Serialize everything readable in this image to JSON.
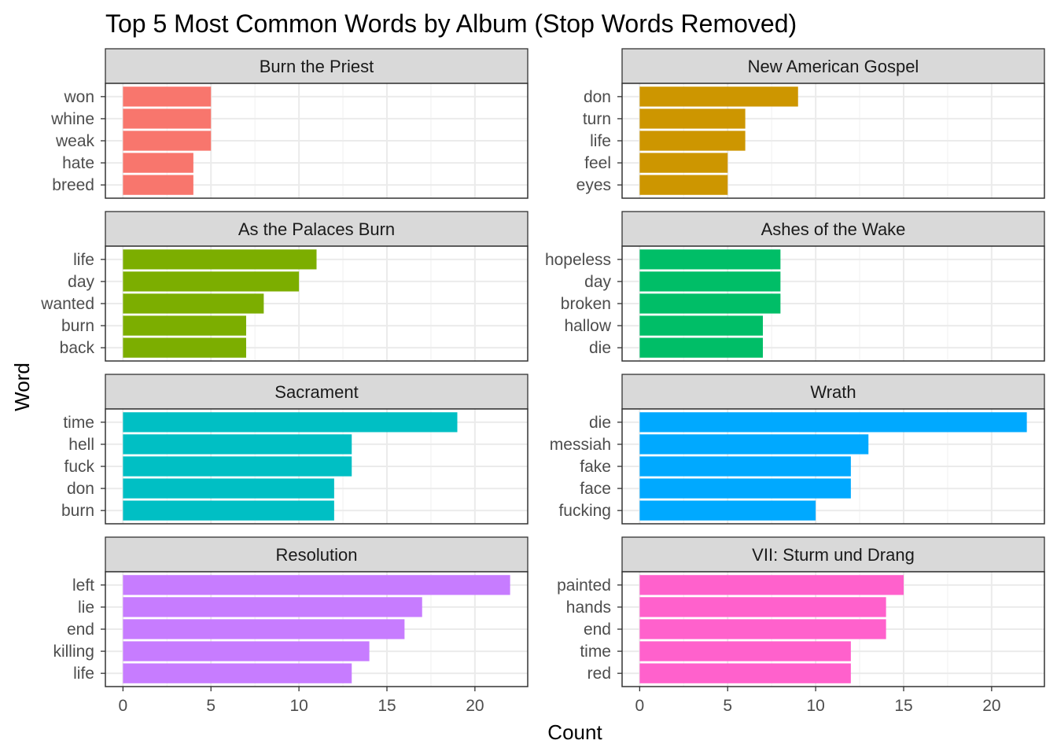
{
  "chart_data": {
    "type": "bar",
    "orientation": "horizontal",
    "title": "Top 5 Most Common Words by Album (Stop Words Removed)",
    "xlabel": "Count",
    "ylabel": "Word",
    "xlim": [
      -1,
      23
    ],
    "x_ticks": [
      0,
      5,
      10,
      15,
      20
    ],
    "grid": true,
    "facets": [
      {
        "album": "Burn the Priest",
        "color": "#F8766D",
        "words": [
          "won",
          "whine",
          "weak",
          "hate",
          "breed"
        ],
        "values": [
          5,
          5,
          5,
          4,
          4
        ]
      },
      {
        "album": "New American Gospel",
        "color": "#CD9600",
        "words": [
          "don",
          "turn",
          "life",
          "feel",
          "eyes"
        ],
        "values": [
          9,
          6,
          6,
          5,
          5
        ]
      },
      {
        "album": "As the Palaces Burn",
        "color": "#7CAE00",
        "words": [
          "life",
          "day",
          "wanted",
          "burn",
          "back"
        ],
        "values": [
          11,
          10,
          8,
          7,
          7
        ]
      },
      {
        "album": "Ashes of the Wake",
        "color": "#00BE67",
        "words": [
          "hopeless",
          "day",
          "broken",
          "hallow",
          "die"
        ],
        "values": [
          8,
          8,
          8,
          7,
          7
        ]
      },
      {
        "album": "Sacrament",
        "color": "#00BFC4",
        "words": [
          "time",
          "hell",
          "fuck",
          "don",
          "burn"
        ],
        "values": [
          19,
          13,
          13,
          12,
          12
        ]
      },
      {
        "album": "Wrath",
        "color": "#00A9FF",
        "words": [
          "die",
          "messiah",
          "fake",
          "face",
          "fucking"
        ],
        "values": [
          22,
          13,
          12,
          12,
          10
        ]
      },
      {
        "album": "Resolution",
        "color": "#C77CFF",
        "words": [
          "left",
          "lie",
          "end",
          "killing",
          "life"
        ],
        "values": [
          22,
          17,
          16,
          14,
          13
        ]
      },
      {
        "album": "VII: Sturm und Drang",
        "color": "#FF61CC",
        "words": [
          "painted",
          "hands",
          "end",
          "time",
          "red"
        ],
        "values": [
          15,
          14,
          14,
          12,
          12
        ]
      }
    ]
  }
}
